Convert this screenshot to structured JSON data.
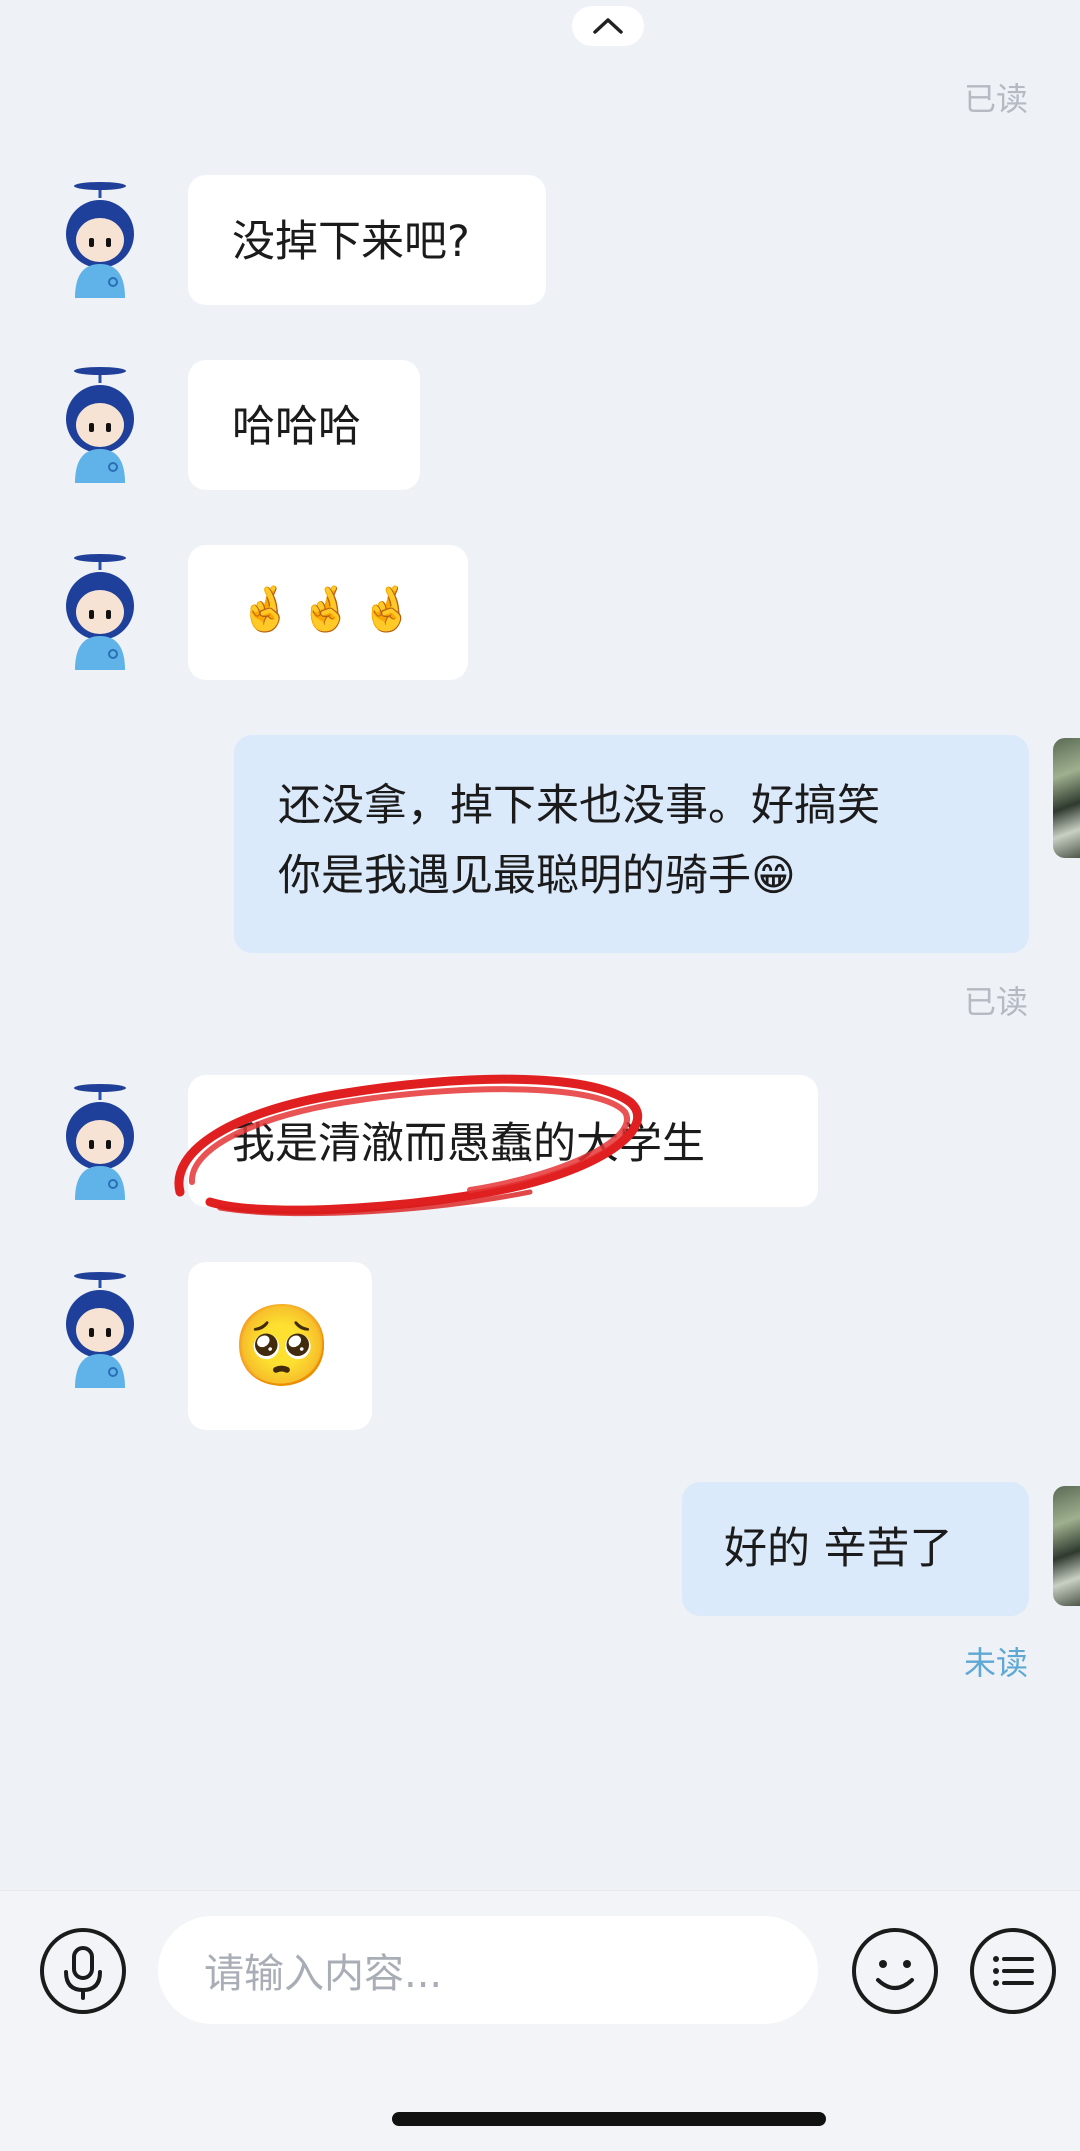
{
  "messages": {
    "read_top": "已读",
    "m1": "没掉下来吧?",
    "m2": "哈哈哈",
    "m3_emoji": "🤞🤞🤞",
    "m4_line1": "还没拿，掉下来也没事。好搞笑",
    "m4_line2": "你是我遇见最聪明的骑手",
    "m4_emoji": "😁",
    "read_mid": "已读",
    "m5": "我是清澈而愚蠢的大学生",
    "m6_emoji": "🥺",
    "m7": "好的 辛苦了",
    "unread": "未读"
  },
  "composer": {
    "placeholder": "请输入内容..."
  },
  "icons": {
    "collapse": "chevron-up-icon",
    "voice": "microphone-icon",
    "emoji": "smiley-icon",
    "more": "list-menu-icon"
  },
  "colors": {
    "background": "#eef1f6",
    "incoming_bubble": "#ffffff",
    "outgoing_bubble": "#dbeafb",
    "read_status": "#b4b9c2",
    "unread_status": "#5fa8d3",
    "annotation_circle": "#e02020"
  }
}
